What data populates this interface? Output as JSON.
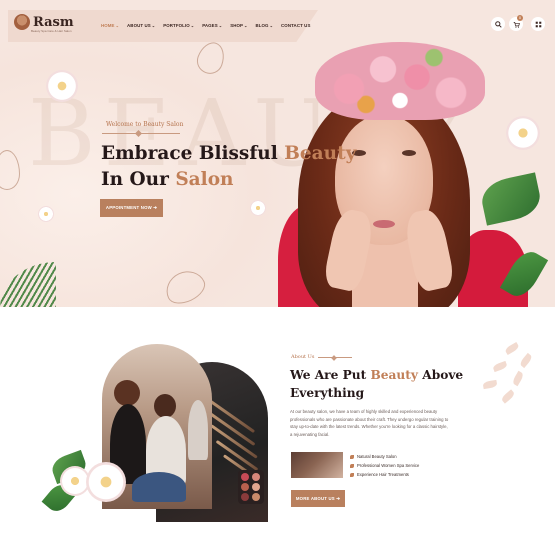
{
  "brand": {
    "name": "Rasm",
    "tagline": "Beauty Spa Care & Hair Salon"
  },
  "nav": {
    "items": [
      {
        "label": "HOME",
        "dropdown": true,
        "active": true
      },
      {
        "label": "ABOUT US",
        "dropdown": true
      },
      {
        "label": "PORTFOLIO",
        "dropdown": true
      },
      {
        "label": "PAGES",
        "dropdown": true
      },
      {
        "label": "SHOP",
        "dropdown": true
      },
      {
        "label": "BLOG",
        "dropdown": true
      },
      {
        "label": "CONTACT US",
        "dropdown": false
      }
    ],
    "cart_count": "0",
    "icons": [
      "search-icon",
      "cart-icon",
      "menu-grid-icon"
    ]
  },
  "hero": {
    "background_word": "BEAUTY",
    "welcome": "Welcome to Beauty Salon",
    "title_line1_plain": "Embrace Blissful ",
    "title_line1_accent": "Beauty",
    "title_line2_plain": "In Our ",
    "title_line2_accent": "Salon",
    "button": "APPOINTMENT NOW ➔"
  },
  "about": {
    "tag": "About Us",
    "title_line1_plain": "We Are Put ",
    "title_line1_accent": "Beauty",
    "title_line1_end": " Above",
    "title_line2": "Everything",
    "text": "At our beauty salon, we have a team of highly skilled and experienced beauty professionals who are passionate about their craft. They undergo regular training to stay up-to-date with the latest trends. Whether you're looking for a classic hairstyle, a rejuvenating facial.",
    "features": [
      "Natural Beauty Salon",
      "Professional Women Spa Service",
      "Experience Hair Treatments"
    ],
    "button": "MORE ABOUT US ➔"
  },
  "colors": {
    "accent": "#c17f57",
    "hero_bg": "#f6e6df",
    "button": "#b9805e",
    "heading": "#251819"
  }
}
